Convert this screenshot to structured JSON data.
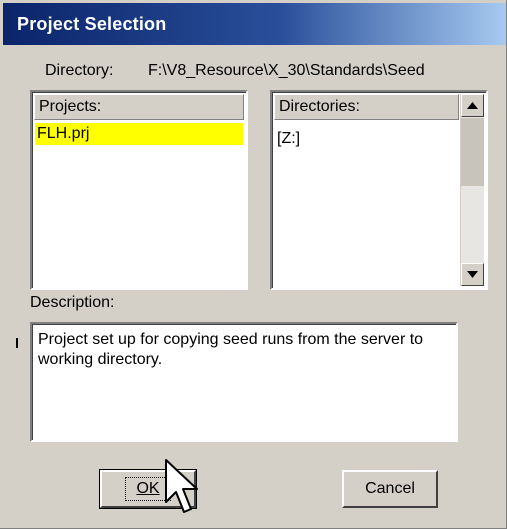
{
  "window": {
    "title": "Project Selection"
  },
  "directory": {
    "label": "Directory:",
    "path": "F:\\V8_Resource\\X_30\\Standards\\Seed"
  },
  "projects": {
    "header": "Projects:",
    "items": [
      {
        "label": "FLH.prj",
        "selected": true
      }
    ]
  },
  "directories": {
    "header": "Directories:",
    "items": [
      {
        "label": "[Z:]"
      }
    ]
  },
  "description": {
    "label": "Description:",
    "text": "Project set up for copying seed runs from the server to working directory."
  },
  "buttons": {
    "ok_label": "OK",
    "cancel_label": "Cancel"
  },
  "icons": {
    "scroll_up": "triangle-up",
    "scroll_down": "triangle-down",
    "cursor": "arrow-pointer"
  },
  "colors": {
    "titlebar_start": "#0a246a",
    "titlebar_end": "#a6caf0",
    "selection": "#ffff00",
    "face": "#d4d0c8"
  }
}
